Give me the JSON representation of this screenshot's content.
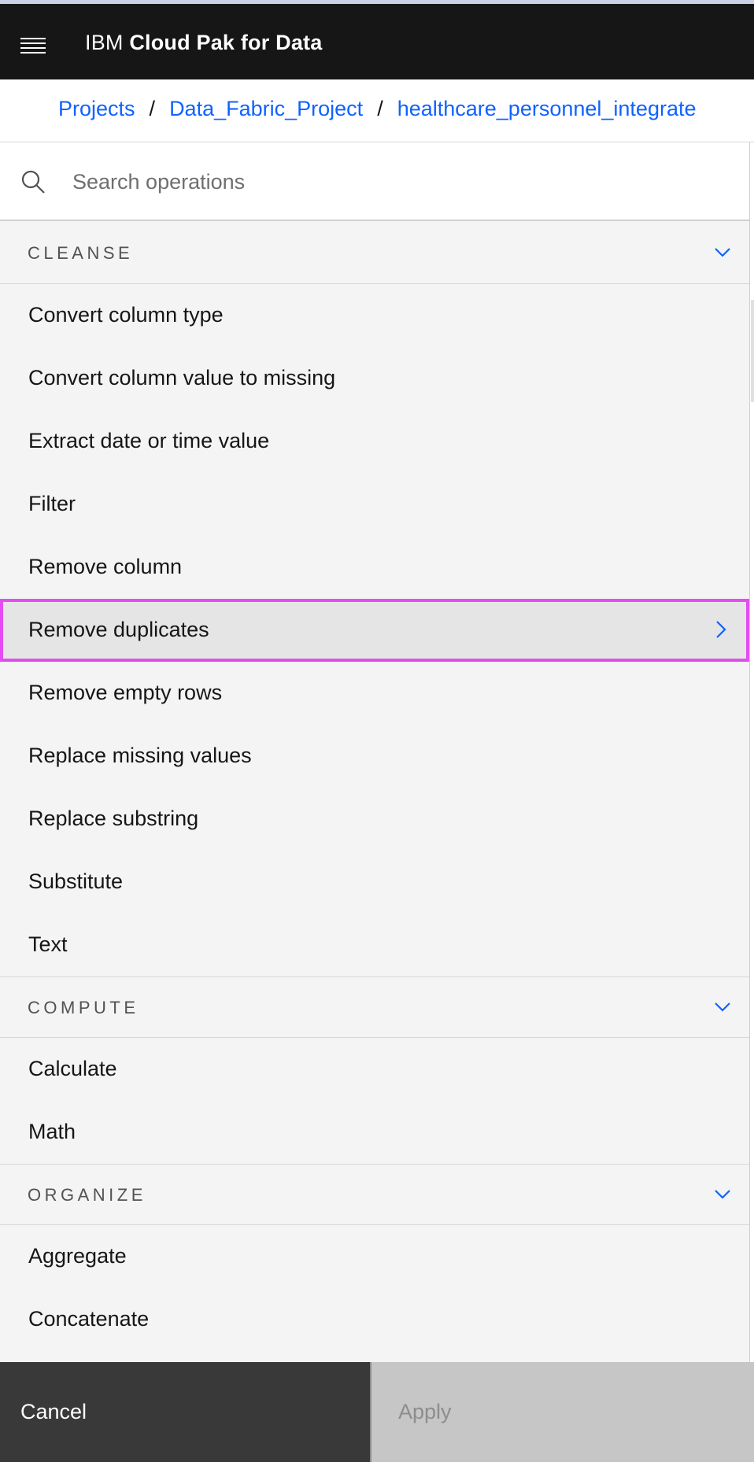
{
  "header": {
    "brand_light": "IBM",
    "brand_bold": "Cloud Pak for Data",
    "menu_icon": "hamburger-menu-icon"
  },
  "breadcrumb": {
    "items": [
      "Projects",
      "Data_Fabric_Project",
      "healthcare_personnel_integrate"
    ],
    "separator": "/"
  },
  "search": {
    "placeholder": "Search operations",
    "value": "",
    "icon": "search-icon"
  },
  "sections": [
    {
      "title": "CLEANSE",
      "items": [
        "Convert column type",
        "Convert column value to missing",
        "Extract date or time value",
        "Filter",
        "Remove column",
        "Remove duplicates",
        "Remove empty rows",
        "Replace missing values",
        "Replace substring",
        "Substitute",
        "Text"
      ],
      "selected": "Remove duplicates"
    },
    {
      "title": "COMPUTE",
      "items": [
        "Calculate",
        "Math"
      ]
    },
    {
      "title": "ORGANIZE",
      "items": [
        "Aggregate",
        "Concatenate"
      ]
    }
  ],
  "footer": {
    "cancel_label": "Cancel",
    "apply_label": "Apply",
    "apply_disabled": true
  },
  "colors": {
    "accent": "#0f62fe",
    "highlight": "#e34cf0",
    "header_bg": "#161616"
  }
}
